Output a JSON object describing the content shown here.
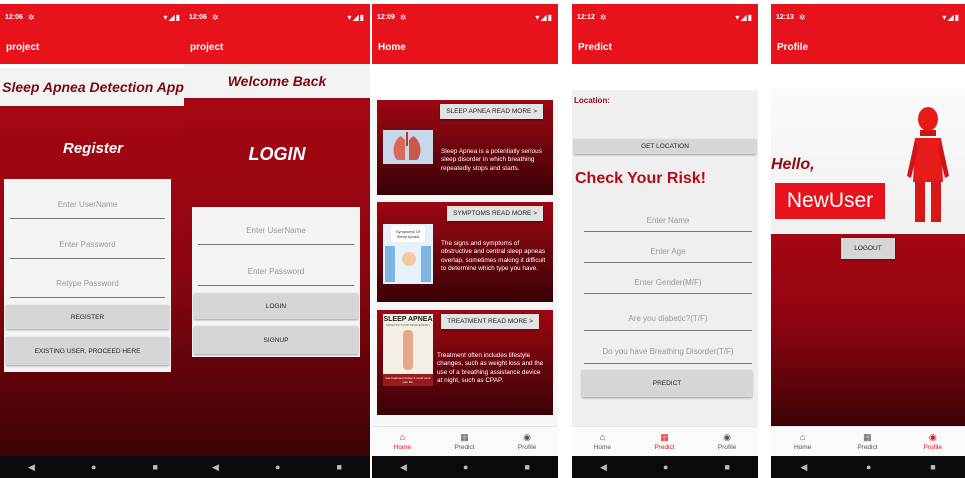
{
  "colors": {
    "brand_red": "#e8121c",
    "dark_red": "#8f0510",
    "title_red": "#7a0b12"
  },
  "register_screen": {
    "status_time": "12:06",
    "appbar_title": "project",
    "header": "Sleep Apnea Detection App",
    "heading": "Register",
    "username_placeholder": "Enter UserName",
    "password_placeholder": "Enter Password",
    "retype_placeholder": "Retype Password",
    "register_button": "REGISTER",
    "existing_user_button": "EXISTING USER, PROCEED HERE"
  },
  "login_screen": {
    "status_time": "12:06",
    "appbar_title": "project",
    "header": "Welcome Back",
    "heading": "LOGIN",
    "username_placeholder": "Enter UserName",
    "password_placeholder": "Enter Password",
    "login_button": "LOGIN",
    "signup_button": "SIGNUP"
  },
  "home_screen": {
    "status_time": "12:09",
    "appbar_title": "Home",
    "cards": [
      {
        "tag": "SLEEP APNEA   READ MORE >",
        "description": "Sleep Apnea is a potentially serious sleep disorder in which breathing repeatedly stops and starts."
      },
      {
        "tag": "SYMPTOMS   READ MORE >",
        "description": "The signs and symptoms of obstructive and central sleep apneas overlap, sometimes making it difficult to determine which type you have."
      },
      {
        "tag": "TREATMENT   READ MORE >",
        "description": "Treatment often includes lifestyle changes, such as weight loss and the use of a breathing assistance device at night, such as CPAP."
      }
    ],
    "thumb_texts": {
      "symptoms": "Symptoms Of Sleep Apnea",
      "treatment_title": "SLEEP APNEA",
      "treatment_sub": "AFFECTS YOUR WHOLE BODY",
      "treatment_footer": "Get treatment today! It could save your life."
    }
  },
  "predict_screen": {
    "status_time": "12:12",
    "appbar_title": "Predict",
    "location_label": "Location:",
    "get_location_button": "GET LOCATION",
    "heading": "Check Your Risk!",
    "fields": [
      "Enter Name",
      "Enter Age",
      "Enter Gender(M/F)",
      "Are you diabetic?(T/F)",
      "Do you have Breathing Disorder(T/F)"
    ],
    "predict_button": "PREDICT"
  },
  "profile_screen": {
    "status_time": "12:13",
    "appbar_title": "Profile",
    "hello": "Hello,",
    "username": "NewUser",
    "logout_button": "LOGOUT"
  },
  "bottom_nav": {
    "home": "Home",
    "predict": "Predict",
    "profile": "Profile"
  },
  "icons": {
    "home": "home-icon",
    "predict": "grid-icon",
    "profile": "account-icon",
    "back": "triangle-back-icon",
    "circle": "circle-home-icon",
    "square": "square-recents-icon"
  }
}
